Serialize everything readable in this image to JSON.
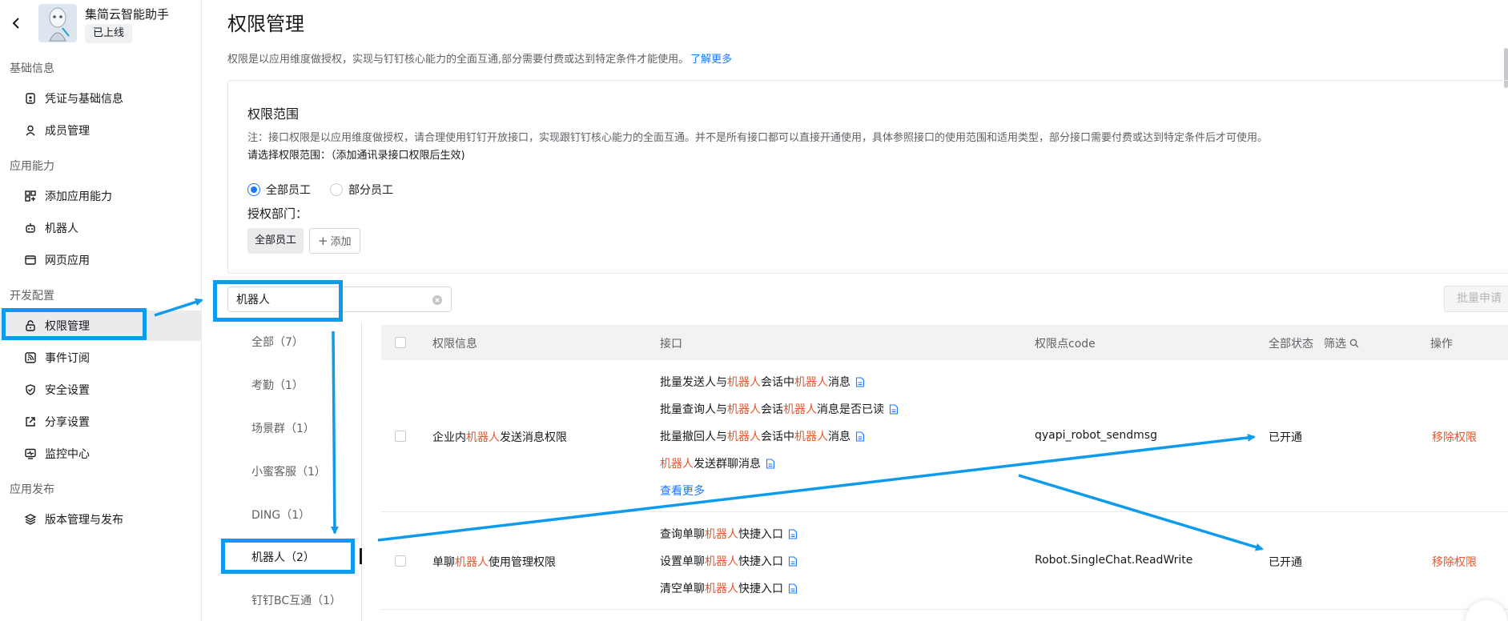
{
  "app": {
    "name": "集简云智能助手",
    "status": "已上线"
  },
  "sidebar": {
    "groups": [
      {
        "label": "基础信息"
      },
      {
        "label": "应用能力"
      },
      {
        "label": "开发配置"
      },
      {
        "label": "应用发布"
      }
    ],
    "items": [
      {
        "label": "凭证与基础信息",
        "icon": "credential-icon"
      },
      {
        "label": "成员管理",
        "icon": "member-icon"
      },
      {
        "label": "添加应用能力",
        "icon": "capability-icon"
      },
      {
        "label": "机器人",
        "icon": "robot-icon"
      },
      {
        "label": "网页应用",
        "icon": "webpage-icon"
      },
      {
        "label": "权限管理",
        "icon": "lock-icon",
        "active": true
      },
      {
        "label": "事件订阅",
        "icon": "rss-icon"
      },
      {
        "label": "安全设置",
        "icon": "shield-icon"
      },
      {
        "label": "分享设置",
        "icon": "share-icon"
      },
      {
        "label": "监控中心",
        "icon": "monitor-icon"
      },
      {
        "label": "版本管理与发布",
        "icon": "layers-icon"
      }
    ]
  },
  "page": {
    "title": "权限管理",
    "description": "权限是以应用维度做授权，实现与钉钉核心能力的全面互通,部分需要付费或达到特定条件才能使用。",
    "learn_more": "了解更多"
  },
  "scope": {
    "title": "权限范围",
    "note": "注：接口权限是以应用维度做授权，请合理使用钉钉开放接口，实现跟钉钉核心能力的全面互通。并不是所有接口都可以直接开通使用，具体参照接口的使用范围和适用类型，部分接口需要付费或达到特定条件后才可使用。",
    "select_label": "请选择权限范围：（添加通讯录接口权限后生效)",
    "options": [
      "全部员工",
      "部分员工"
    ],
    "selected": "全部员工",
    "dept_label": "授权部门：",
    "dept_tag": "全部员工",
    "add_label": "添加"
  },
  "search": {
    "value": "机器人",
    "placeholder": ""
  },
  "batch_button": "批量申请",
  "categories": [
    {
      "label": "全部（7）"
    },
    {
      "label": "考勤（1）"
    },
    {
      "label": "场景群（1）"
    },
    {
      "label": "小蜜客服（1）"
    },
    {
      "label": "DING（1）"
    },
    {
      "label": "机器人（2）",
      "active": true
    },
    {
      "label": "钉钉BC互通（1）"
    }
  ],
  "table": {
    "headers": {
      "info": "权限信息",
      "api": "接口",
      "code": "权限点code",
      "status": "全部状态",
      "filter": "筛选",
      "action": "操作"
    },
    "rows": [
      {
        "name_parts": [
          "企业内",
          "机器人",
          "发送消息权限"
        ],
        "apis": [
          [
            "批量发送人与",
            "机器人",
            "会话中",
            "机器人",
            "消息"
          ],
          [
            "批量查询人与",
            "机器人",
            "会话",
            "机器人",
            "消息是否已读"
          ],
          [
            "批量撤回人与",
            "机器人",
            "会话中",
            "机器人",
            "消息"
          ],
          [
            "",
            "机器人",
            "发送群聊消息",
            "",
            ""
          ]
        ],
        "more": "查看更多",
        "code": "qyapi_robot_sendmsg",
        "status": "已开通",
        "action": "移除权限"
      },
      {
        "name_parts": [
          "单聊",
          "机器人",
          "使用管理权限"
        ],
        "apis": [
          [
            "查询单聊",
            "机器人",
            "快捷入口",
            "",
            ""
          ],
          [
            "设置单聊",
            "机器人",
            "快捷入口",
            "",
            ""
          ],
          [
            "清空单聊",
            "机器人",
            "快捷入口",
            "",
            ""
          ]
        ],
        "code": "Robot.SingleChat.ReadWrite",
        "status": "已开通",
        "action": "移除权限"
      }
    ]
  },
  "colors": {
    "accent": "#1677ff",
    "highlight": "#e8562a",
    "annotation": "#0f9bec"
  }
}
